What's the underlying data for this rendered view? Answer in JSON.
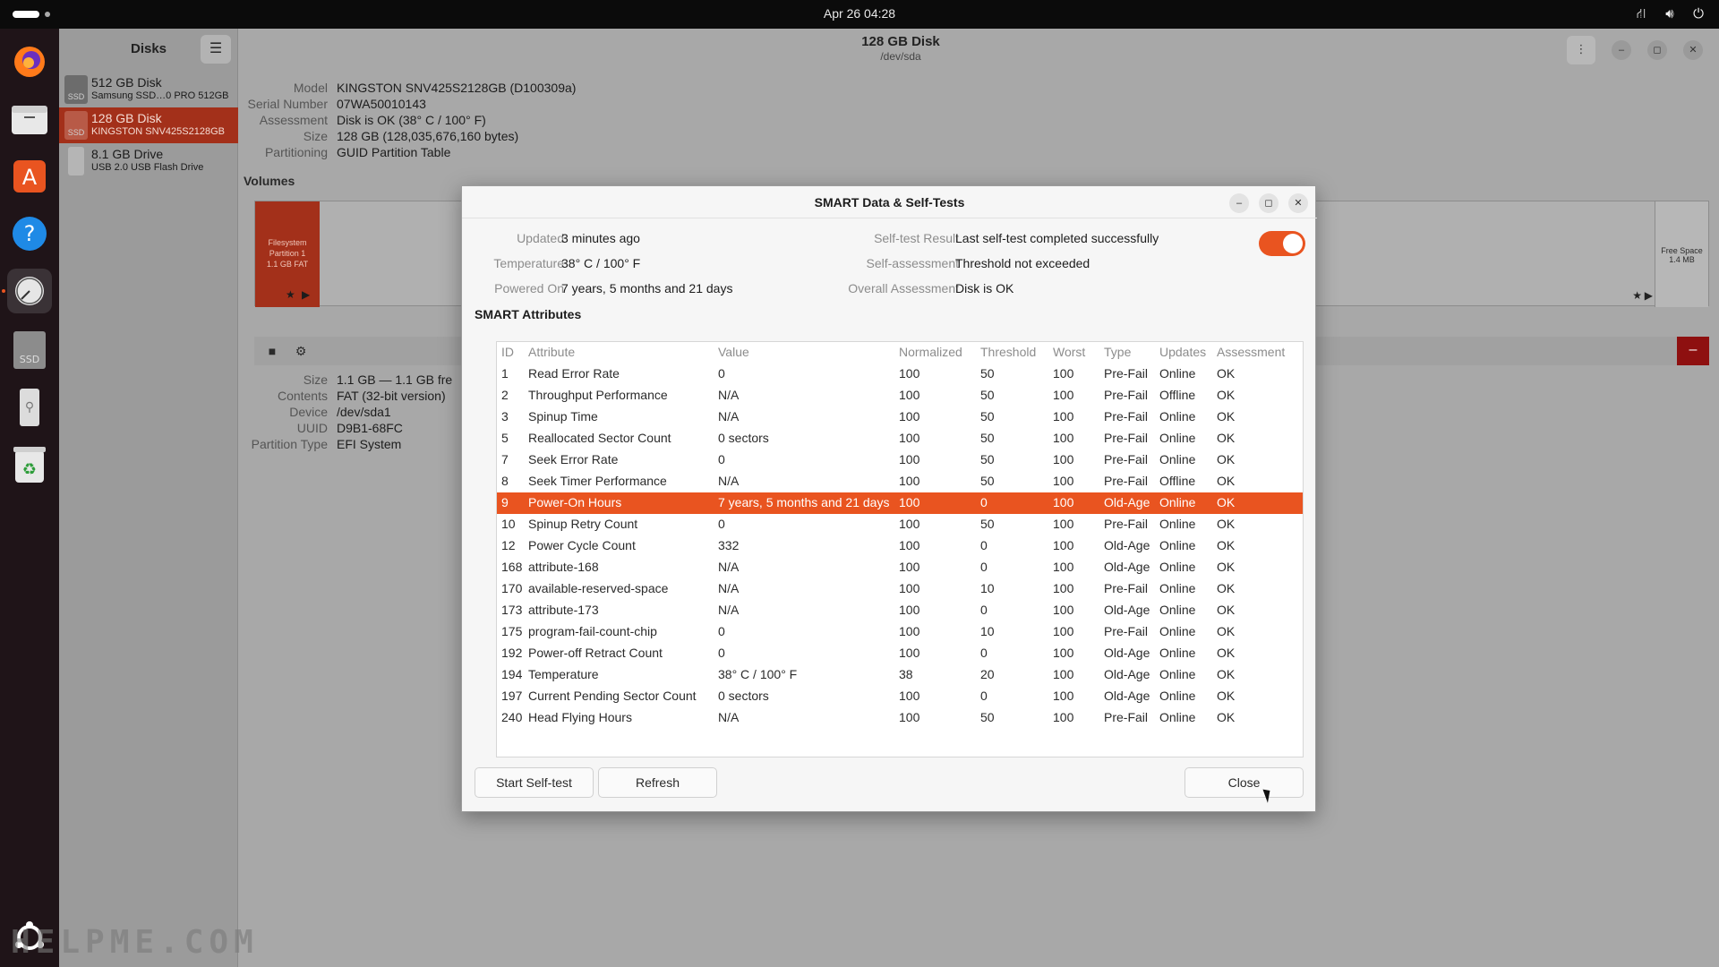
{
  "topbar": {
    "clock": "Apr 26  04:28",
    "tray_icons": [
      "network-icon",
      "volume-icon",
      "power-icon"
    ]
  },
  "dock": {
    "apps": [
      "Firefox",
      "Files",
      "App Center",
      "Help",
      "Disks",
      "SSD",
      "USB Drive",
      "Trash",
      "Show Apps"
    ]
  },
  "sidebar": {
    "title": "Disks",
    "disks": [
      {
        "name": "512 GB Disk",
        "sub": "Samsung SSD…0 PRO 512GB",
        "icon_label": "SSD"
      },
      {
        "name": "128 GB Disk",
        "sub": "KINGSTON SNV425S2128GB",
        "icon_label": "SSD"
      },
      {
        "name": "8.1 GB Drive",
        "sub": "USB 2.0 USB Flash Drive",
        "icon_label": ""
      }
    ]
  },
  "header": {
    "title": "128 GB Disk",
    "subtitle": "/dev/sda"
  },
  "disk_info": [
    {
      "key": "Model",
      "value": "KINGSTON SNV425S2128GB (D100309a)"
    },
    {
      "key": "Serial Number",
      "value": "07WA50010143"
    },
    {
      "key": "Assessment",
      "value": "Disk is OK (38° C / 100° F)"
    },
    {
      "key": "Size",
      "value": "128 GB (128,035,676,160 bytes)"
    },
    {
      "key": "Partitioning",
      "value": "GUID Partition Table"
    }
  ],
  "volumes": {
    "title": "Volumes",
    "partition_label_1": "Filesystem",
    "partition_label_2": "Partition 1",
    "partition_label_3": "1.1 GB FAT",
    "free_label_1": "Free Space",
    "free_label_2": "1.4 MB"
  },
  "volume_info": [
    {
      "key": "Size",
      "value": "1.1 GB — 1.1 GB fre"
    },
    {
      "key": "Contents",
      "value": "FAT (32-bit version)"
    },
    {
      "key": "Device",
      "value": "/dev/sda1"
    },
    {
      "key": "UUID",
      "value": "D9B1-68FC"
    },
    {
      "key": "Partition Type",
      "value": "EFI System"
    }
  ],
  "watermark": "HELPME.COM",
  "dialog": {
    "title": "SMART Data & Self-Tests",
    "summary_left": [
      {
        "key": "Updated",
        "value": "3 minutes ago"
      },
      {
        "key": "Temperature",
        "value": "38° C / 100° F"
      },
      {
        "key": "Powered On",
        "value": "7 years, 5 months and 21 days"
      }
    ],
    "summary_right": [
      {
        "key": "Self-test Result",
        "value": "Last self-test completed successfully"
      },
      {
        "key": "Self-assessment",
        "value": "Threshold not exceeded"
      },
      {
        "key": "Overall Assessment",
        "value": "Disk is OK"
      }
    ],
    "smart_enabled": true,
    "attributes_title": "SMART Attributes",
    "columns": [
      "ID",
      "Attribute",
      "Value",
      "Normalized",
      "Threshold",
      "Worst",
      "Type",
      "Updates",
      "Assessment"
    ],
    "rows": [
      [
        "1",
        "Read Error Rate",
        "0",
        "100",
        "50",
        "100",
        "Pre-Fail",
        "Online",
        "OK"
      ],
      [
        "2",
        "Throughput Performance",
        "N/A",
        "100",
        "50",
        "100",
        "Pre-Fail",
        "Offline",
        "OK"
      ],
      [
        "3",
        "Spinup Time",
        "N/A",
        "100",
        "50",
        "100",
        "Pre-Fail",
        "Online",
        "OK"
      ],
      [
        "5",
        "Reallocated Sector Count",
        "0 sectors",
        "100",
        "50",
        "100",
        "Pre-Fail",
        "Online",
        "OK"
      ],
      [
        "7",
        "Seek Error Rate",
        "0",
        "100",
        "50",
        "100",
        "Pre-Fail",
        "Online",
        "OK"
      ],
      [
        "8",
        "Seek Timer Performance",
        "N/A",
        "100",
        "50",
        "100",
        "Pre-Fail",
        "Offline",
        "OK"
      ],
      [
        "9",
        "Power-On Hours",
        "7 years, 5 months and 21 days",
        "100",
        "0",
        "100",
        "Old-Age",
        "Online",
        "OK"
      ],
      [
        "10",
        "Spinup Retry Count",
        "0",
        "100",
        "50",
        "100",
        "Pre-Fail",
        "Online",
        "OK"
      ],
      [
        "12",
        "Power Cycle Count",
        "332",
        "100",
        "0",
        "100",
        "Old-Age",
        "Online",
        "OK"
      ],
      [
        "168",
        "attribute-168",
        "N/A",
        "100",
        "0",
        "100",
        "Old-Age",
        "Online",
        "OK"
      ],
      [
        "170",
        "available-reserved-space",
        "N/A",
        "100",
        "10",
        "100",
        "Pre-Fail",
        "Online",
        "OK"
      ],
      [
        "173",
        "attribute-173",
        "N/A",
        "100",
        "0",
        "100",
        "Old-Age",
        "Online",
        "OK"
      ],
      [
        "175",
        "program-fail-count-chip",
        "0",
        "100",
        "10",
        "100",
        "Pre-Fail",
        "Online",
        "OK"
      ],
      [
        "192",
        "Power-off Retract Count",
        "0",
        "100",
        "0",
        "100",
        "Old-Age",
        "Online",
        "OK"
      ],
      [
        "194",
        "Temperature",
        "38° C / 100° F",
        "38",
        "20",
        "100",
        "Old-Age",
        "Online",
        "OK"
      ],
      [
        "197",
        "Current Pending Sector Count",
        "0 sectors",
        "100",
        "0",
        "100",
        "Old-Age",
        "Online",
        "OK"
      ],
      [
        "240",
        "Head Flying Hours",
        "N/A",
        "100",
        "50",
        "100",
        "Pre-Fail",
        "Online",
        "OK"
      ]
    ],
    "selected_row_index": 6,
    "buttons": {
      "start_selftest": "Start Self-test",
      "refresh": "Refresh",
      "close": "Close"
    }
  },
  "colors": {
    "accent": "#e95420",
    "selected_sidebar": "#a3301a"
  }
}
